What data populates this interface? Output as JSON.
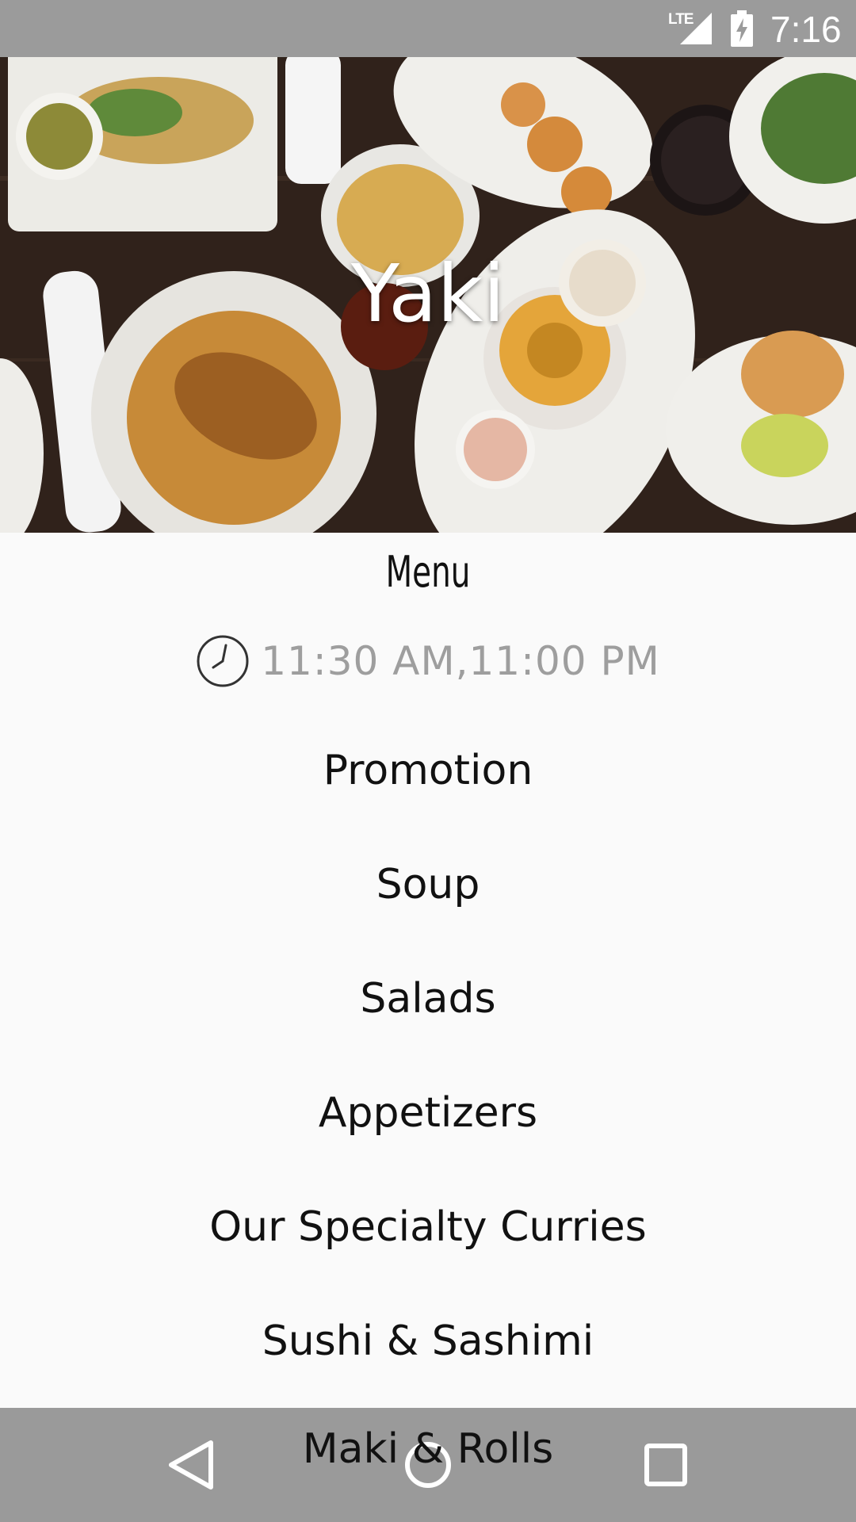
{
  "status_bar": {
    "network": "LTE",
    "time": "7:16",
    "icons": [
      "lte-signal-icon",
      "battery-charging-icon"
    ]
  },
  "hero": {
    "title": "Yaki"
  },
  "menu": {
    "heading": "Menu",
    "hours": "11:30 AM,11:00 PM",
    "hours_icon": "clock-icon",
    "categories": [
      "Promotion",
      "Soup",
      "Salads",
      "Appetizers",
      "Our Specialty Curries",
      "Sushi & Sashimi",
      "Maki & Rolls"
    ]
  },
  "nav_bar": {
    "icons": [
      "back-icon",
      "home-icon",
      "recents-icon"
    ]
  },
  "colors": {
    "status_bar": "#9b9b9b",
    "background": "#fafafa",
    "hours_text": "#9e9e9e",
    "nav_bar": "#969696"
  }
}
